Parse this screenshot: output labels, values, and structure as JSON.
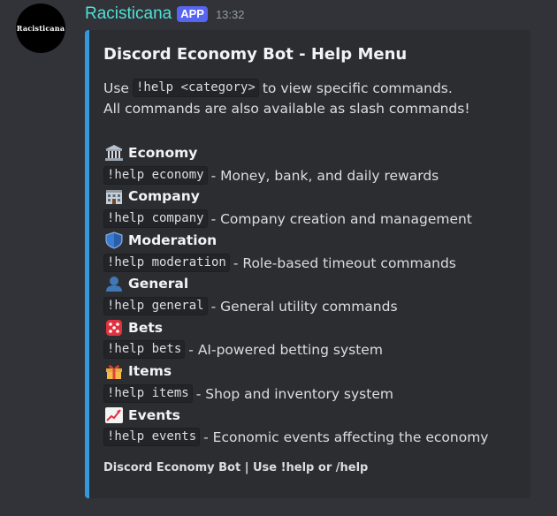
{
  "author": {
    "name": "Racisticana",
    "avatar_text": "Racisticana",
    "badge": "APP",
    "timestamp": "13:32"
  },
  "embed": {
    "accent_color": "#3498db",
    "title": "Discord Economy Bot - Help Menu",
    "intro": {
      "prefix": "Use",
      "code": "!help <category>",
      "suffix": "to view specific commands.",
      "line2": "All commands are also available as slash commands!"
    },
    "categories": [
      {
        "icon": "bank-icon",
        "name": "Economy",
        "command": "!help economy",
        "description": "- Money, bank, and daily rewards"
      },
      {
        "icon": "building-icon",
        "name": "Company",
        "command": "!help company",
        "description": "- Company creation and management"
      },
      {
        "icon": "shield-icon",
        "name": "Moderation",
        "command": "!help moderation",
        "description": "- Role-based timeout commands"
      },
      {
        "icon": "person-icon",
        "name": "General",
        "command": "!help general",
        "description": "- General utility commands"
      },
      {
        "icon": "dice-icon",
        "name": "Bets",
        "command": "!help bets",
        "description": "- AI-powered betting system"
      },
      {
        "icon": "gift-icon",
        "name": "Items",
        "command": "!help items",
        "description": "- Shop and inventory system"
      },
      {
        "icon": "chart-up-icon",
        "name": "Events",
        "command": "!help events",
        "description": "- Economic events affecting the economy"
      }
    ],
    "footer": "Discord Economy Bot | Use !help or /help"
  }
}
